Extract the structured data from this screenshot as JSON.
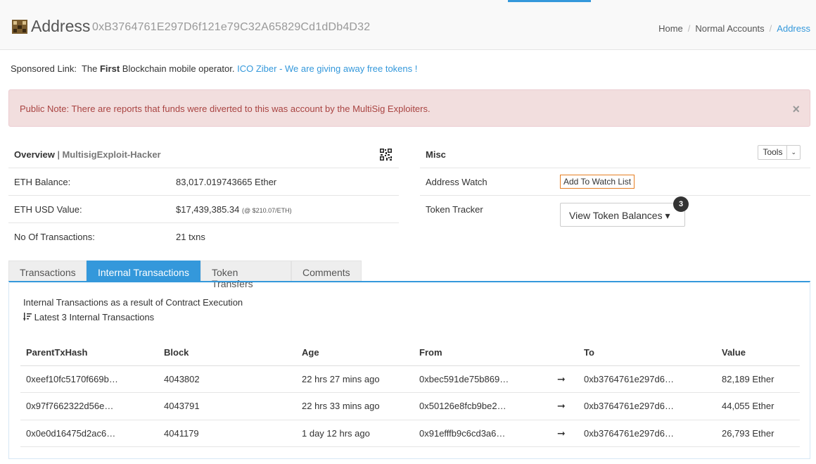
{
  "header": {
    "title": "Address",
    "address": "0xB3764761E297D6f121e79C32A65829Cd1dDb4D32",
    "breadcrumb": [
      "Home",
      "Normal Accounts",
      "Address"
    ]
  },
  "sponsor": {
    "label": "Sponsored Link:",
    "text_pre": "The",
    "text_bold": "First",
    "text_post": "Blockchain mobile operator.",
    "link": "ICO Ziber - We are giving away free tokens !"
  },
  "alert": {
    "text": "Public Note: There are reports that funds were diverted to this was account by the MultiSig Exploiters.",
    "close": "×"
  },
  "overview": {
    "title": "Overview",
    "separator": "|",
    "tag": "MultisigExploit-Hacker",
    "rows": [
      {
        "label": "ETH Balance:",
        "value": "83,017.019743665 Ether"
      },
      {
        "label": "ETH USD Value:",
        "value": "$17,439,385.34",
        "note": "(@ $210.07/ETH)"
      },
      {
        "label": "No Of Transactions:",
        "value": "21 txns"
      }
    ]
  },
  "misc": {
    "title": "Misc",
    "tools_label": "Tools",
    "tools_caret": "⌄",
    "watch_label": "Address Watch",
    "watch_button": "Add To Watch List",
    "token_label": "Token Tracker",
    "token_button": "View Token Balances ▾",
    "token_count": "3"
  },
  "tabs": [
    "Transactions",
    "Internal Transactions",
    "Token Transfers",
    "Comments"
  ],
  "internal": {
    "description": "Internal Transactions as a result of Contract Execution",
    "latest": "Latest 3 Internal Transactions",
    "columns": [
      "ParentTxHash",
      "Block",
      "Age",
      "From",
      "",
      "To",
      "Value"
    ],
    "rows": [
      {
        "hash": "0xeef10fc5170f669b…",
        "block": "4043802",
        "age": "22 hrs 27 mins ago",
        "from": "0xbec591de75b869…",
        "arrow": "➞",
        "to": "0xb3764761e297d6…",
        "value": "82,189 Ether"
      },
      {
        "hash": "0x97f7662322d56e…",
        "block": "4043791",
        "age": "22 hrs 33 mins ago",
        "from": "0x50126e8fcb9be2…",
        "arrow": "➞",
        "to": "0xb3764761e297d6…",
        "value": "44,055 Ether"
      },
      {
        "hash": "0x0e0d16475d2ac6…",
        "block": "4041179",
        "age": "1 day 12 hrs ago",
        "from": "0x91efffb9c6cd3a6…",
        "arrow": "➞",
        "to": "0xb3764761e297d6…",
        "value": "26,793 Ether"
      }
    ]
  },
  "colors": {
    "accent": "#3498db",
    "alert_bg": "#f2dede",
    "alert_text": "#a94442",
    "watch_border": "#e67e22"
  }
}
